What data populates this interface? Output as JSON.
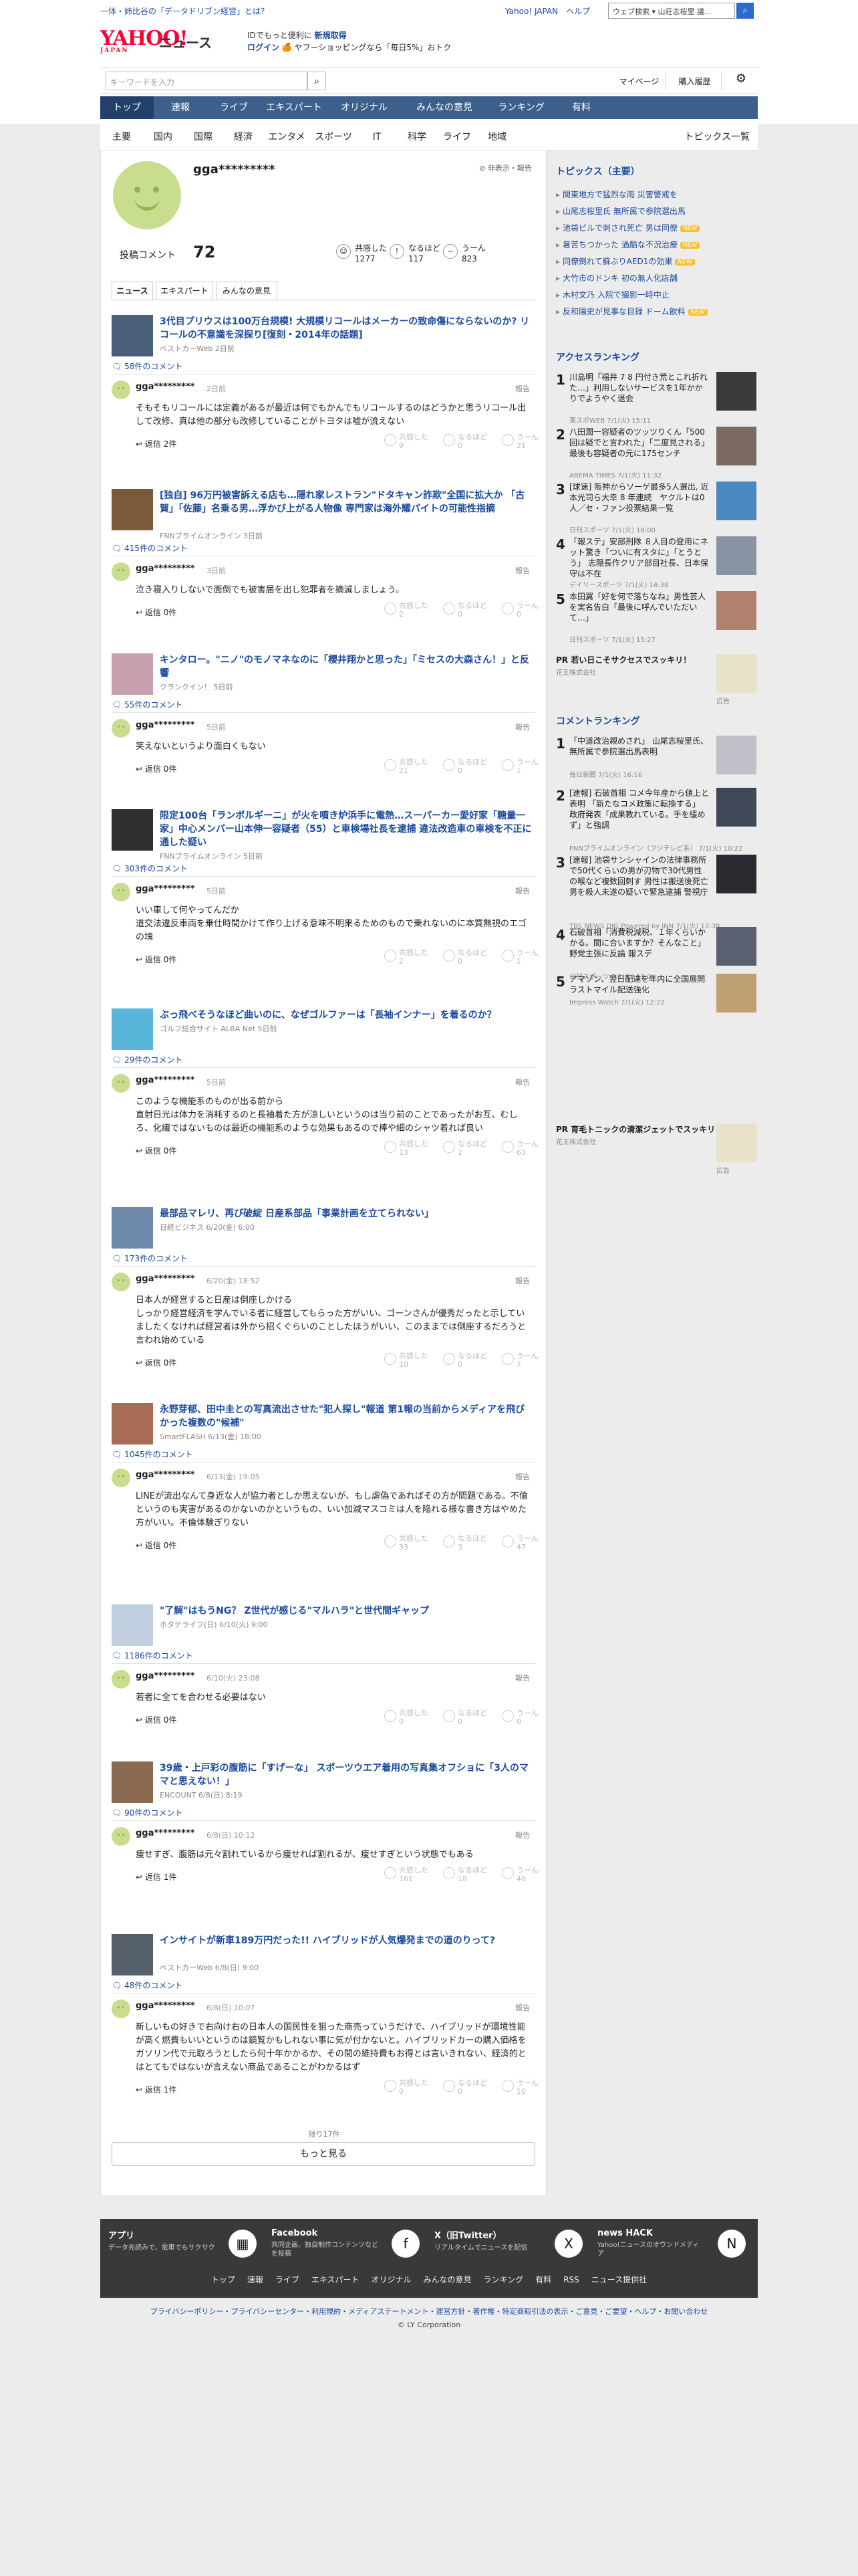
{
  "topbar": {
    "news": "一体・姉比谷の「データドリブン経営」とは？",
    "links": "Yahoo! JAPAN　ヘルプ",
    "search_value": "ウェブ検索",
    "search_query": "山莊志桜里 議...",
    "search_icon": "search-icon"
  },
  "header": {
    "logo": "YAHOO!",
    "logo_sub": "JAPAN",
    "service": "ニュース",
    "promo_text": "IDでもっと便利に",
    "promo_link": "新規取得",
    "login": "ログイン",
    "promo2": "🍊 ヤフーショッピングなら「毎日5%」おトク"
  },
  "search": {
    "placeholder": "キーワードを入力",
    "mypage": "マイページ",
    "history": "購入履歴"
  },
  "nav_main": [
    "トップ",
    "速報",
    "ライブ",
    "エキスパート",
    "オリジナル",
    "みんなの意見",
    "ランキング",
    "有料"
  ],
  "nav_sub": [
    "主要",
    "国内",
    "国際",
    "経済",
    "エンタメ",
    "スポーツ",
    "IT",
    "科学",
    "ライフ",
    "地域"
  ],
  "nav_sub_all": "トピックス一覧",
  "profile": {
    "name": "gga*********",
    "report": "非表示・報告",
    "comments_label": "投稿コメント",
    "comments_count": "72",
    "stats": [
      {
        "label": "共感した",
        "value": "1277"
      },
      {
        "label": "なるほど",
        "value": "117"
      },
      {
        "label": "うーん",
        "value": "823"
      }
    ]
  },
  "tabs": [
    "ニュース",
    "エキスパート",
    "みんなの意見"
  ],
  "articles": [
    {
      "title": "3代目プリウスは100万台規模! 大規模リコールはメーカーの致命傷にならないのか? リコールの不意識を深探り[復刻・2014年の話題]",
      "source": "ベストカーWeb 2日前",
      "count": "58件のコメント",
      "comment": {
        "name": "gga*********",
        "date": "2日前",
        "text": "そもそもリコールには定義があるが最近は何でもかんでもリコールするのはどうかと思うリコール出して改修、真は他の部分も改修していることがトヨタは嘘が流えない",
        "reply": "返信 2件",
        "r": [
          "9",
          "0",
          "21"
        ]
      }
    },
    {
      "title": "[独自] 96万円被害訴える店も…隠れ家レストラン\"ドタキャン詐欺\"全国に拡大か 「古賀」「佐藤」名乗る男…浮かび上がる人物像 専門家は海外耀パイトの可能性指摘",
      "source": "FNNプライムオンライン 3日前",
      "count": "415件のコメント",
      "comment": {
        "name": "gga*********",
        "date": "3日前",
        "text": "泣き寝入りしないで面倒でも被害届を出し犯罪者を摘滅しましょう。",
        "reply": "返信 0件",
        "r": [
          "2",
          "0",
          "0"
        ]
      }
    },
    {
      "title": "キンタロー。\"ニノ\"のモノマネなのに「櫻井翔かと思った」「ミセスの大森さん！」と反響",
      "source": "クランクイン！ 5日前",
      "count": "55件のコメント",
      "comment": {
        "name": "gga*********",
        "date": "5日前",
        "text": "笑えないというより面白くもない",
        "reply": "返信 0件",
        "r": [
          "21",
          "0",
          "1"
        ]
      }
    },
    {
      "title": "限定100台「ランボルギーニ」が火を噴き炉浜手に電熱…スーパーカー愛好家「糖量一家」中心メンバー山本伸一容疑者（55）と車検場社長を逮捕 違法改造車の車検を不正に通した疑い",
      "source": "FNNプライムオンライン 5日前",
      "count": "303件のコメント",
      "comment": {
        "name": "gga*********",
        "date": "5日前",
        "text": "いい車して何やってんだか\n道交法違反車両を乗仕時間かけて作り上げる意味不明果るためのもので乗れないのに本質無視のエゴの塊",
        "reply": "返信 0件",
        "r": [
          "2",
          "0",
          "1"
        ]
      }
    },
    {
      "title": "ぶっ飛べそうなほど曲いのに、なぜゴルファーは「長袖インナー」を着るのか？",
      "source": "ゴルフ総合サイト ALBA Net 5日前",
      "count": "29件のコメント",
      "comment": {
        "name": "gga*********",
        "date": "5日前",
        "text": "このような機能系のものが出る前から\n直射日光は体力を消耗するのと長袖着た方が涼しいというのは当り前のことであったがお互、むしろ、化繊ではないものは最近の機能系のような効果もあるので棒や細のシャツ着れば良い",
        "reply": "返信 0件",
        "r": [
          "13",
          "2",
          "63"
        ]
      }
    },
    {
      "title": "最部品マレリ、再び破綻 日産系部品「事業計画を立てられない」",
      "source": "日経ビジネス 6/20(金) 6:00",
      "count": "173件のコメント",
      "comment": {
        "name": "gga*********",
        "date": "6/20(金) 18:52",
        "text": "日本人が経営すると日産は倒座しかける\nしっかり経営経済を学んでいる者に経営してもらった方がいい、ゴーンさんが優秀だったと示していましたくなければ経営者は外から招くぐらいのことしたほうがいい、このままでは倒座するだろうと言われ始めている",
        "reply": "返信 0件",
        "r": [
          "10",
          "0",
          "7"
        ]
      }
    },
    {
      "title": "永野芽郁、田中圭との写真流出させた\"犯人探し\"報道 第1報の当前からメディアを飛びかった複数の\"候補\"",
      "source": "SmartFLASH 6/13(金) 18:00",
      "count": "1045件のコメント",
      "comment": {
        "name": "gga*********",
        "date": "6/13(金) 19:05",
        "text": "LINEが流出なんて身近な人が協力者としか思えないが、もし虐偽であればその方が問題である。不倫というのも実害があるのかないのかというもの、いい加減マスコミは人を陥れる様な書き方はやめた方がいい。不倫体験ぎりない",
        "reply": "返信 0件",
        "r": [
          "33",
          "3",
          "47"
        ]
      }
    },
    {
      "title": "\"了解\"はもうNG？ Z世代が感じる\"マルハラ\"と世代間ギャップ",
      "source": "ホタテライフ(日) 6/10(火) 9:00",
      "count": "1186件のコメント",
      "comment": {
        "name": "gga*********",
        "date": "6/10(火) 23:08",
        "text": "若者に全てを合わせる必要はない",
        "reply": "返信 0件",
        "r": [
          "0",
          "0",
          "0"
        ]
      }
    },
    {
      "title": "39歳・上戸彩の腹筋に「すげーな」 スポーツウエア着用の写真集オフショに「3人のママと思えない！」",
      "source": "ENCOUNT 6/8(日) 8:19",
      "count": "90件のコメント",
      "comment": {
        "name": "gga*********",
        "date": "6/8(日) 10:12",
        "text": "痩せすぎ、腹筋は元々割れているから痩せれば割れるが、痩せすぎという状態でもある",
        "reply": "返信 1件",
        "r": [
          "161",
          "18",
          "48"
        ]
      }
    },
    {
      "title": "インサイトが新車189万円だった!! ハイブリッドが人気爆発までの道のりって?",
      "source": "ベストカーWeb 6/8(日) 9:00",
      "count": "48件のコメント",
      "comment": {
        "name": "gga*********",
        "date": "6/8(日) 10:07",
        "text": "新しいもの好きで右向け右の日本人の国民性を狙った商売っていうだけで、ハイブリッドが環境性能が高く燃費もいいというのは鏡覧かもしれない事に気が付かないと。ハイブリッドカーの購入価格をガソリン代で元取ろうとしたら何十年かかるか、その間の維持費もお得とは言いきれない、経済的とはとてもではないが言えない商品であることがわかるはず",
        "reply": "返信 1件",
        "r": [
          "0",
          "0",
          "10"
        ]
      }
    }
  ],
  "reactions": [
    "共感した",
    "なるほど",
    "うーん"
  ],
  "report_label": "報告",
  "more": {
    "remaining": "残り17件",
    "button": "もっと見る"
  },
  "sidebar": {
    "topics_title": "トピックス（主要）",
    "topics": [
      "関東地方で猛烈な雨 災害警戒を",
      "山尾志桜里氏 無所属で参院選出馬",
      "池袋ビルで刺され死亡 男は同僚",
      "暑苦ちつかった 過酷な不況治療",
      "同僚倒れて蘇ぶりAED1の効果",
      "大竹市のドンキ 初の無人化店舗",
      "木村文乃 入院で撮影一時中止",
      "反和陽史が見事な目録 ドーム飲料"
    ],
    "topic_badges": [
      false,
      false,
      true,
      true,
      true,
      false,
      false,
      true
    ],
    "access_title": "アクセスランキング",
    "access": [
      {
        "t": "川島明「福井 7 8 円付き荒とこれ折れた…」利用しないサービスを1年かかりでようやく退会",
        "s": "東スポWEB 7/1(火) 15:11"
      },
      {
        "t": "八田潤一容疑者のツッツりくん「500回は疑でと言われた」「二度見される」 最後も容疑者の元に175センチ",
        "s": "ABEMA TIMES 7/1(火) 11:32"
      },
      {
        "t": "[球速] 阪神からソーゲ最多5人選出, 近本光司ら大幸 8 年連続　ヤクルトは0人／セ・ファン投票結果一覧",
        "s": "日刊スポーツ 7/1(火) 18:00"
      },
      {
        "t": "「報ステ」安部刑隊 ８人目の登用にネット驚き「ついに有スタに」「とうとう」 志隠長作クリア部目社長、日本保守は不在",
        "s": "デイリースポーツ 7/1(火) 14:38"
      },
      {
        "t": "本田翼「好を何で落ちなね」男性芸人を実名告白「最後に呼んでいただいて…」",
        "s": "日刊スポーツ 7/1(火) 15:27"
      }
    ],
    "ad1": {
      "t": "若い日こそサクセスでスッキリ！",
      "s": "花王株式会社"
    },
    "ad_label": "広告",
    "comment_title": "コメントランキング",
    "comment_rank": [
      {
        "t": "「中道改治親めされ」 山尾志桜里氏、無所属で参院選出馬表明",
        "s": "毎日新聞 7/1(火) 16:16"
      },
      {
        "t": "[速報] 石破首相 コメ今年産から値上と表明 「新たなコメ政策に転換する」 政府発表「成果教れている。手を緩めず」と強調",
        "s": "FNNプライムオンライン（フジテレビ系） 7/1(火) 10:22"
      },
      {
        "t": "[速報] 池袋サンシャインの法律事務所で50代くらいの男が刃物で30代男性の喉など複数回刺す 男性は搬送後死亡 男を殺人未遂の疑いで緊急逮捕 警視庁",
        "s": "TBS NEWS DIG Powered by JNN 7/1(火) 13:38"
      },
      {
        "t": "石破首相「消費税減税、１年くらいかかる。間に合いますか？そんなこと」野党主張に反論 報スデ",
        "s": "日刊スポーツ 7/1(火) 11:04"
      },
      {
        "t": "アマゾン、翌日配達を年内に全国展開 ラストマイル配送強化",
        "s": "Impress Watch 7/1(火) 12:22"
      }
    ],
    "ad2": {
      "t": "育毛トニックの清潔ジェットでスッキリ！",
      "s": "花王株式会社"
    }
  },
  "footer": {
    "items": [
      {
        "t": "アプリ",
        "d": "データ先読みで、電車でもサクサク",
        "icon": "app-icon"
      },
      {
        "t": "Facebook",
        "d": "共同企画、独自制作コンテンツなどを投稿",
        "icon": "facebook-icon"
      },
      {
        "t": "X（旧Twitter）",
        "d": "リアルタイムでニュースを配信",
        "icon": "x-icon"
      },
      {
        "t": "news HACK",
        "d": "Yahoo!ニュースのオウンドメディア",
        "icon": "newshack-icon"
      }
    ],
    "nav": [
      "トップ",
      "速報",
      "ライブ",
      "エキスパート",
      "オリジナル",
      "みんなの意見",
      "ランキング",
      "有料",
      "RSS",
      "ニュース提供社"
    ],
    "legal": "プライバシーポリシー・プライバシーセンター・利用規約・メディアステートメント・運営方針・著作権・特定商取引法の表示・ご意見・ご要望・ヘルプ・お問い合わせ",
    "copyright": "© LY Corporation"
  },
  "colors": {
    "nav": "#3d5f8c",
    "link": "#1a4a9e",
    "avatar": "#c8de8e"
  }
}
